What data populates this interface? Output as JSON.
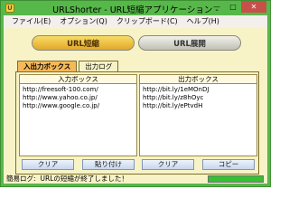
{
  "window": {
    "title": "URLShorter - URL短縮アプリケーション -",
    "icon_text": "U"
  },
  "window_controls": {
    "minimize": "—",
    "maximize": "□",
    "close": "✕"
  },
  "menu": [
    "ファイル(E)",
    "オプション(Q)",
    "クリップボード(C)",
    "ヘルプ(H)"
  ],
  "actions": {
    "shorten": "URL短縮",
    "expand": "URL展開"
  },
  "tabs": [
    {
      "label": "入出力ボックス"
    },
    {
      "label": "出力ログ"
    }
  ],
  "input_box": {
    "header": "入力ボックス",
    "lines": [
      "http://freesoft-100.com/",
      "http://www.yahoo.co.jp/",
      "http://www.google.co.jp/"
    ],
    "clear_label": "クリア",
    "paste_label": "貼り付け"
  },
  "output_box": {
    "header": "出力ボックス",
    "lines": [
      "http://bit.ly/1eMOnDJ",
      "http://bit.ly/z8hOyc",
      "http://bit.ly/ePtvdH"
    ],
    "clear_label": "クリア",
    "copy_label": "コピー"
  },
  "status": {
    "label": "簡易ログ:",
    "message": "URLの短縮が終了しました！",
    "progress": 1.0
  },
  "colors": {
    "window_frame": "#57b84a",
    "client_bg": "#f7f3c7",
    "active_tab": "#f6b95a",
    "progress": "#35c035"
  }
}
